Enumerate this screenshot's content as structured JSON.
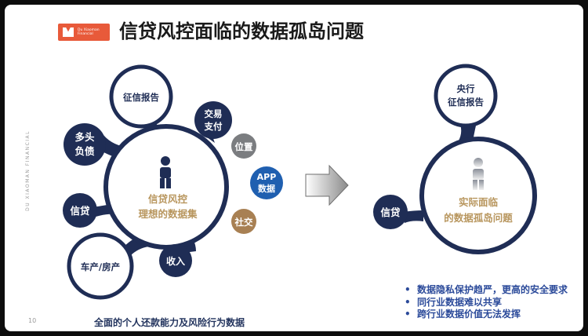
{
  "slide": {
    "title": "信贷风控面临的数据孤岛问题",
    "logo": {
      "line1": "Du Xiaoman",
      "line2": "Financial"
    },
    "side_label": "DU XIAOMAN  FINANCIAL",
    "page_number": "10",
    "left_center": {
      "line1": "信贷风控",
      "line2": "理想的数据集"
    },
    "left_nodes": {
      "credit_report": "征信报告",
      "transaction": {
        "line1": "交易",
        "line2": "支付"
      },
      "multi_debt": {
        "line1": "多头",
        "line2": "负债"
      },
      "loan": "信贷",
      "car_house": "车产/房产",
      "income": "收入",
      "location": "位置",
      "app": {
        "line1": "APP",
        "line2": "数据"
      },
      "social": "社交"
    },
    "left_caption": "全面的个人还款能力及风险行为数据",
    "right_center": {
      "line1": "实际面临",
      "line2": "的数据孤岛问题"
    },
    "right_nodes": {
      "central_bank": {
        "line1": "央行",
        "line2": "征信报告"
      },
      "loan": "信贷"
    },
    "bullets": [
      "数据隐私保护趋严，更高的安全要求",
      "同行业数据难以共享",
      "跨行业数据价值无法发挥"
    ],
    "colors": {
      "navy": "#1f2d55",
      "gold": "#b8965e",
      "gray": "#7b7d80",
      "brown": "#a88053",
      "blue": "#1f5fb0",
      "logo": "#e85a3a"
    }
  }
}
